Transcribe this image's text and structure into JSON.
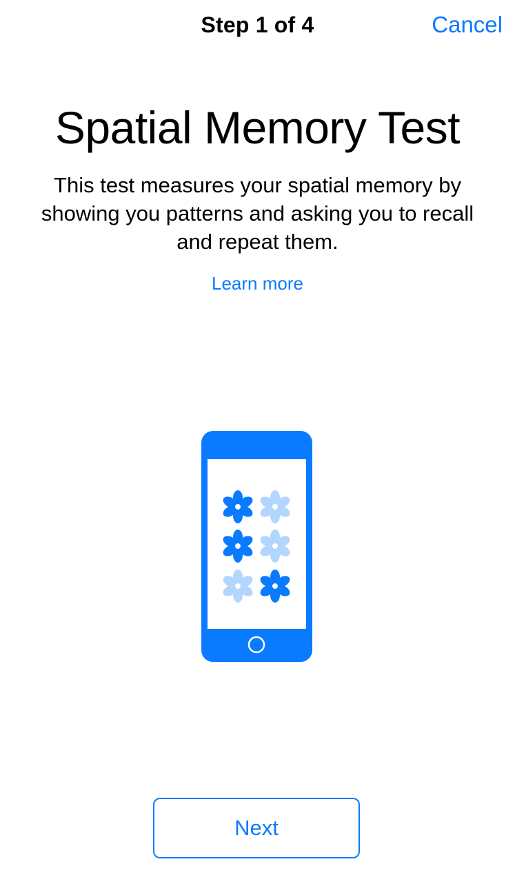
{
  "navbar": {
    "step_label": "Step 1 of 4",
    "cancel_label": "Cancel"
  },
  "main": {
    "title": "Spatial Memory Test",
    "description": "This test measures your spatial memory by showing you patterns and asking you to recall and repeat them.",
    "learn_more_label": "Learn more"
  },
  "illustration": {
    "icon": "phone-with-flowers-icon",
    "flowers": [
      {
        "row": 1,
        "col": 1,
        "state": "highlighted"
      },
      {
        "row": 1,
        "col": 2,
        "state": "dimmed"
      },
      {
        "row": 2,
        "col": 1,
        "state": "highlighted"
      },
      {
        "row": 2,
        "col": 2,
        "state": "dimmed"
      },
      {
        "row": 3,
        "col": 1,
        "state": "dimmed"
      },
      {
        "row": 3,
        "col": 2,
        "state": "highlighted"
      }
    ]
  },
  "footer": {
    "next_label": "Next"
  },
  "colors": {
    "accent": "#0a7aff",
    "flower_dimmed": "#b3d6ff",
    "text": "#000000",
    "background": "#ffffff"
  }
}
